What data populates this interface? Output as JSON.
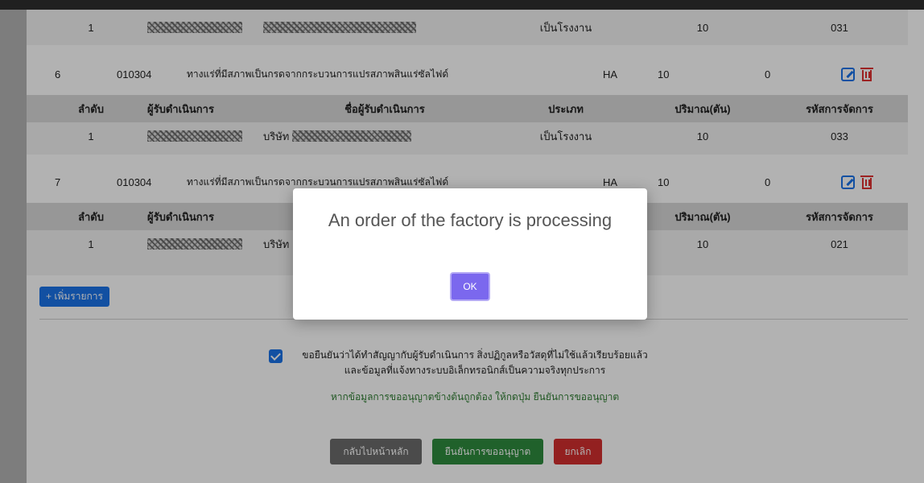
{
  "table": {
    "groups": [
      {
        "main": null,
        "sub": {
          "rows": [
            {
              "no": "1",
              "type": "เป็นโรงงาน",
              "amount": "10",
              "code": "031",
              "company_prefix": ""
            }
          ]
        }
      },
      {
        "main": {
          "no": "6",
          "waste_code": "010304",
          "desc": "ทางแร่ที่มีสภาพเป็นกรดจากกระบวนการแปรสภาพสินแร่ซัลไฟด์",
          "category": "HA",
          "qty": "10",
          "other": "0"
        },
        "sub": {
          "headers": {
            "no": "ลำดับ",
            "operator": "ผู้รับดำเนินการ",
            "operator_name": "ชื่อผู้รับดำเนินการ",
            "type": "ประเภท",
            "amount": "ปริมาณ(ตัน)",
            "code": "รหัสการจัดการ"
          },
          "rows": [
            {
              "no": "1",
              "type": "เป็นโรงงาน",
              "amount": "10",
              "code": "033",
              "company_prefix": "บริษัท"
            }
          ]
        }
      },
      {
        "main": {
          "no": "7",
          "waste_code": "010304",
          "desc": "ทางแร่ที่มีสภาพเป็นกรดจากกระบวนการแปรสภาพสินแร่ซัลไฟด์",
          "category": "HA",
          "qty": "10",
          "other": "0"
        },
        "sub": {
          "headers": {
            "no": "ลำดับ",
            "operator": "ผู้รับดำเนินการ",
            "amount": "ปริมาณ(ตัน)",
            "code": "รหัสการจัดการ"
          },
          "rows": [
            {
              "no": "1",
              "amount": "10",
              "code": "021",
              "company_prefix": "บริษัท"
            }
          ]
        }
      }
    ]
  },
  "add_button": "+ เพิ่มรายการ",
  "confirm": {
    "line1": "ขอยืนยันว่าได้ทำสัญญากับผู้รับดำเนินการ สิ่งปฏิกูลหรือวัสดุที่ไม่ใช้แล้วเรียบร้อยแล้ว",
    "line2": "และข้อมูลที่แจ้งทางระบบอิเล็กทรอนิกส์เป็นความจริงทุกประการ",
    "note": "หากข้อมูลการขออนุญาตข้างต้นถูกต้อง ให้กดปุ่ม ยืนยันการขออนุญาต"
  },
  "buttons": {
    "back": "กลับไปหน้าหลัก",
    "confirm": "ยืนยันการขออนุญาต",
    "cancel": "ยกเลิก"
  },
  "modal": {
    "title": "An order of the factory is processing",
    "ok": "OK"
  },
  "colors": {
    "primary": "#1a73e8",
    "success": "#2e8b3e",
    "danger": "#d32f2f",
    "secondary": "#6c6c6c",
    "modal_ok": "#7b68ee"
  }
}
